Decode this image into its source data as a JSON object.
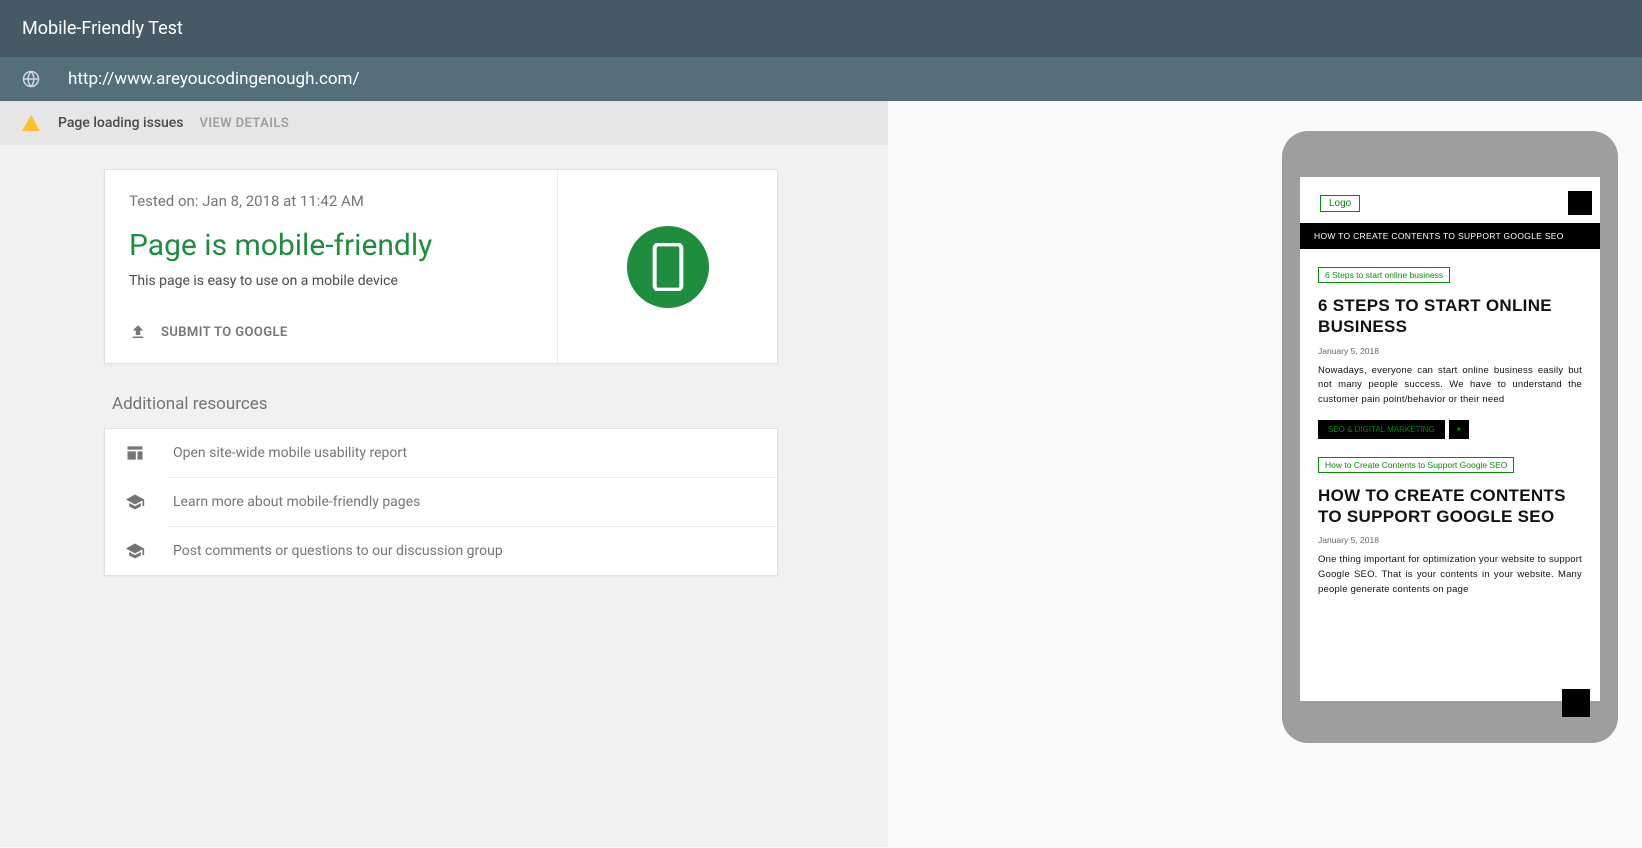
{
  "header": {
    "title": "Mobile-Friendly Test"
  },
  "url": "http://www.areyoucodingenough.com/",
  "banner": {
    "text": "Page loading issues",
    "action": "VIEW DETAILS"
  },
  "result": {
    "tested_on": "Tested on: Jan 8, 2018 at 11:42 AM",
    "verdict": "Page is mobile-friendly",
    "subtext": "This page is easy to use on a mobile device",
    "submit_label": "SUBMIT TO GOOGLE"
  },
  "resources": {
    "title": "Additional resources",
    "items": [
      "Open site-wide mobile usability report",
      "Learn more about mobile-friendly pages",
      "Post comments or questions to our discussion group"
    ]
  },
  "preview": {
    "logo": "Logo",
    "bar": "HOW TO CREATE CONTENTS TO SUPPORT GOOGLE SEO",
    "posts": [
      {
        "tag": "6 Steps to start online business",
        "title": "6 STEPS TO START ONLINE BUSINESS",
        "date": "January 5, 2018",
        "body": "Nowadays, everyone can start online business easily but not many people success. We have to understand the customer pain point/behavior or their need",
        "chip": "SEO & DIGITAL MARKETING"
      },
      {
        "tag": "How to Create Contents to Support Google SEO",
        "title": "HOW TO CREATE CONTENTS TO SUPPORT GOOGLE SEO",
        "date": "January 5, 2018",
        "body": "One thing important for optimization your website to support Google SEO. That is your contents in your website. Many people generate contents on page"
      }
    ]
  }
}
